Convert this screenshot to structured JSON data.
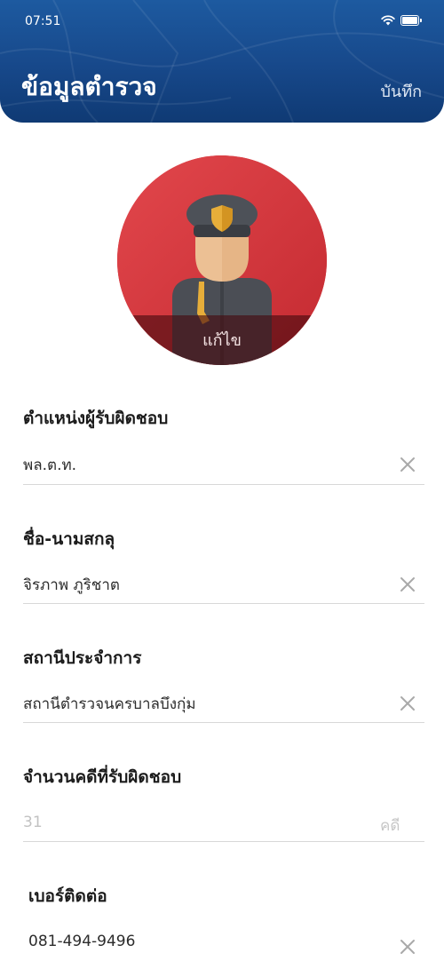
{
  "status_bar": {
    "time": "07:51",
    "icons": [
      "wifi-icon",
      "battery-icon"
    ]
  },
  "header": {
    "title": "ข้อมูลตำรวจ",
    "save_label": "บันทึก",
    "background_color": "#17488a"
  },
  "avatar": {
    "edit_label": "แก้ไข",
    "background_color": "#d6343b"
  },
  "fields": [
    {
      "label": "ตำแหน่งผู้รับผิดชอบ",
      "value": "พล.ต.ท.",
      "action_icon": "clear-icon"
    },
    {
      "label": "ชื่อ-นามสกลุ",
      "value": "จิรภาพ ภูริชาต",
      "action_icon": "clear-icon"
    },
    {
      "label": "สถานีประจำการ",
      "value": "สถานีตำรวจนครบาลบึงกุ่ม",
      "action_icon": "clear-icon"
    },
    {
      "label": "จำนวนคดีที่รับผิดชอบ",
      "placeholder": "31",
      "unit": "คดี"
    },
    {
      "label": "เบอร์ติดต่อ",
      "value": "081-494-9496",
      "action_icon": "clear-icon"
    }
  ]
}
